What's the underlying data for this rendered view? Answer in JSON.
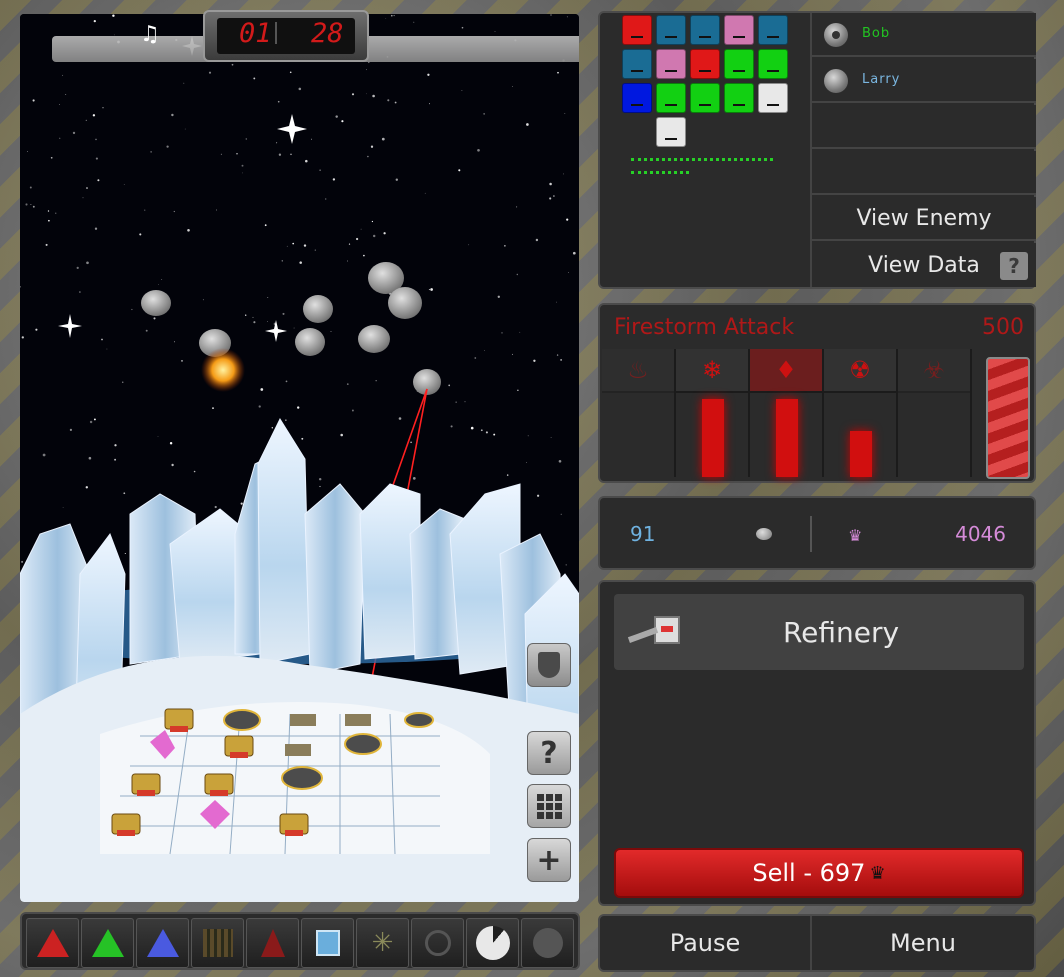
{
  "hud": {
    "music_icon": "music-note-icon",
    "timer_minutes": "01",
    "timer_seconds": "28"
  },
  "viewport_buttons": [
    {
      "name": "shield-button",
      "icon": "shield-icon"
    },
    {
      "name": "help-button",
      "label": "?",
      "icon": "question-icon"
    },
    {
      "name": "grid-button",
      "icon": "grid-icon"
    },
    {
      "name": "zoom-in-button",
      "label": "+",
      "icon": "plus-icon"
    }
  ],
  "toolbar": [
    {
      "name": "tool-red-tower",
      "icon": "red-tower-icon",
      "color": "#cc2222"
    },
    {
      "name": "tool-green-tower",
      "icon": "green-tower-icon",
      "color": "#26c226"
    },
    {
      "name": "tool-blue-tower",
      "icon": "blue-tower-icon",
      "color": "#4a5ae0"
    },
    {
      "name": "tool-wall",
      "icon": "wall-icon",
      "color": "#5a4a2a"
    },
    {
      "name": "tool-missile",
      "icon": "missile-icon",
      "color": "#8a1a1a"
    },
    {
      "name": "tool-refinery",
      "icon": "refinery-icon",
      "color": "#6aaedc"
    },
    {
      "name": "tool-radar",
      "icon": "radar-icon",
      "color": "#8a8a5a"
    },
    {
      "name": "tool-target",
      "icon": "crosshair-icon",
      "color": "#555555"
    },
    {
      "name": "tool-sell",
      "icon": "pie-icon",
      "color": "#e8e8e8"
    },
    {
      "name": "tool-crown",
      "icon": "crown-icon",
      "color": "#555555"
    }
  ],
  "inventory": {
    "colors": {
      "red": "#e01818",
      "teal": "#1a6c94",
      "pink": "#d078b0",
      "green": "#12d012",
      "blue": "#0018e0",
      "white": "#e8e8e8"
    },
    "rows": [
      [
        "red",
        "teal",
        "teal",
        "pink",
        "teal"
      ],
      [
        "teal",
        "pink",
        "red",
        "green",
        "green"
      ],
      [
        "blue",
        "green",
        "green",
        "green",
        "white"
      ],
      [
        "",
        "white",
        "",
        "",
        ""
      ]
    ],
    "progress_dots": [
      18,
      8
    ]
  },
  "players": [
    {
      "name": "Bob",
      "color": "#22c422",
      "selected": true
    },
    {
      "name": "Larry",
      "color": "#7ab6e0",
      "selected": false
    }
  ],
  "buttons": {
    "view_enemy": "View Enemy",
    "view_data": "View Data",
    "view_data_help": "?"
  },
  "attack": {
    "name": "Firestorm Attack",
    "cost": "500",
    "weapons": [
      {
        "icon": "flame-spread-icon",
        "glyph": "♨",
        "level": 0
      },
      {
        "icon": "snowflake-icon",
        "glyph": "❄",
        "level": 0.6
      },
      {
        "icon": "fire-icon",
        "glyph": "♦",
        "level": 0.6,
        "active": true
      },
      {
        "icon": "radiation-icon",
        "glyph": "☢",
        "level": 0.35
      },
      {
        "icon": "biohazard-icon",
        "glyph": "☣",
        "level": 0
      }
    ],
    "launch_icon": "launch-chevrons-icon"
  },
  "resources": {
    "ore": "91",
    "ore_icon": "ore-rock-icon",
    "crystal": "4046",
    "crystal_icon": "crystal-crown-icon"
  },
  "building": {
    "name": "Refinery",
    "icon": "refinery-icon",
    "sell_label": "Sell  -  697",
    "sell_icon": "crown-icon"
  },
  "controls": {
    "pause": "Pause",
    "menu": "Menu"
  }
}
